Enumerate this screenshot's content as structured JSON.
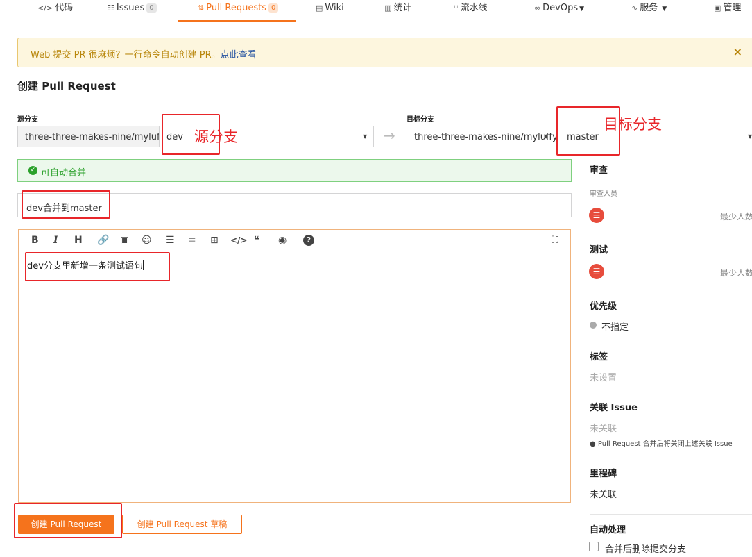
{
  "nav": {
    "code": "代码",
    "issues": "Issues",
    "issues_count": "0",
    "pull_requests": "Pull Requests",
    "pull_requests_count": "0",
    "wiki": "Wiki",
    "stats": "统计",
    "pipeline": "流水线",
    "devops": "DevOps",
    "service": "服务",
    "manage": "管理"
  },
  "banner": {
    "text": "Web 提交 PR 很麻烦？一行命令自动创建 PR。",
    "link": "点此查看",
    "close": "×"
  },
  "page_title": "创建 Pull Request",
  "source": {
    "label": "源分支",
    "repo": "three-three-makes-nine/myluffy",
    "branch": "dev",
    "annotation": "源分支"
  },
  "target": {
    "label": "目标分支",
    "repo": "three-three-makes-nine/myluffy",
    "branch": "master",
    "annotation": "目标分支"
  },
  "arrow": "→",
  "merge_status": "可自动合并",
  "title_value": "dev合并到master",
  "editor": {
    "toolbar": [
      "B",
      "I",
      "H",
      "🔗",
      "▣",
      "☺",
      "☰",
      "≡",
      "⊞",
      "</>",
      "❝",
      "◉",
      "?",
      "⛶"
    ],
    "body": "dev分支里新增一条测试语句"
  },
  "buttons": {
    "create": "创建 Pull Request",
    "draft": "创建 Pull Request 草稿"
  },
  "sidebar": {
    "review_heading": "审查",
    "reviewers_label": "审查人员",
    "review_min": "最少人数",
    "test_heading": "测试",
    "test_min": "最少人数",
    "priority_heading": "优先级",
    "priority_value": "不指定",
    "tags_heading": "标签",
    "tags_value": "未设置",
    "issue_heading": "关联 Issue",
    "issue_value": "未关联",
    "issue_note": "Pull Request 合并后将关闭上述关联 Issue",
    "milestone_heading": "里程碑",
    "milestone_value": "未关联",
    "auto_heading": "自动处理",
    "auto_option": "合并后删除提交分支"
  },
  "colors": {
    "accent": "#f5731c",
    "annotation_red": "#e8262a",
    "success": "#2ba12b"
  }
}
